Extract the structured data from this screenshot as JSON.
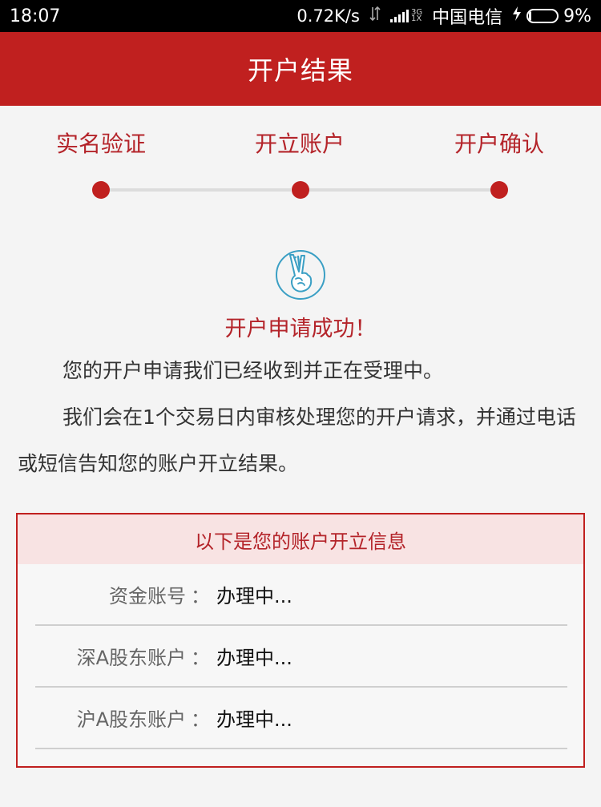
{
  "status_bar": {
    "time": "18:07",
    "net_speed": "0.72K/s",
    "network_type": "3G\n1X",
    "carrier": "中国电信",
    "battery_percent": "9%",
    "battery_level": 0.09,
    "icons": [
      "data-transfer-icon",
      "signal-icon",
      "charging-icon",
      "battery-icon"
    ]
  },
  "header": {
    "title": "开户结果"
  },
  "steps": [
    {
      "label": "实名验证"
    },
    {
      "label": "开立账户"
    },
    {
      "label": "开户确认"
    }
  ],
  "result": {
    "icon": "victory-hand-icon",
    "title": "开户申请成功！",
    "paragraph1": "您的开户申请我们已经收到并正在受理中。",
    "paragraph2": "我们会在1个交易日内审核处理您的开户请求，并通过电话或短信告知您的账户开立结果。"
  },
  "account_info": {
    "heading": "以下是您的账户开立信息",
    "rows": [
      {
        "key": "资金账号",
        "sep": "：",
        "value": "办理中..."
      },
      {
        "key": "深A股东账户",
        "sep": "：",
        "value": "办理中..."
      },
      {
        "key": "沪A股东账户",
        "sep": "：",
        "value": "办理中..."
      }
    ]
  },
  "colors": {
    "accent": "#c0201f",
    "accent_text": "#b4242a",
    "info_header_bg": "#f8e3e3",
    "page_bg": "#f4f4f4"
  }
}
